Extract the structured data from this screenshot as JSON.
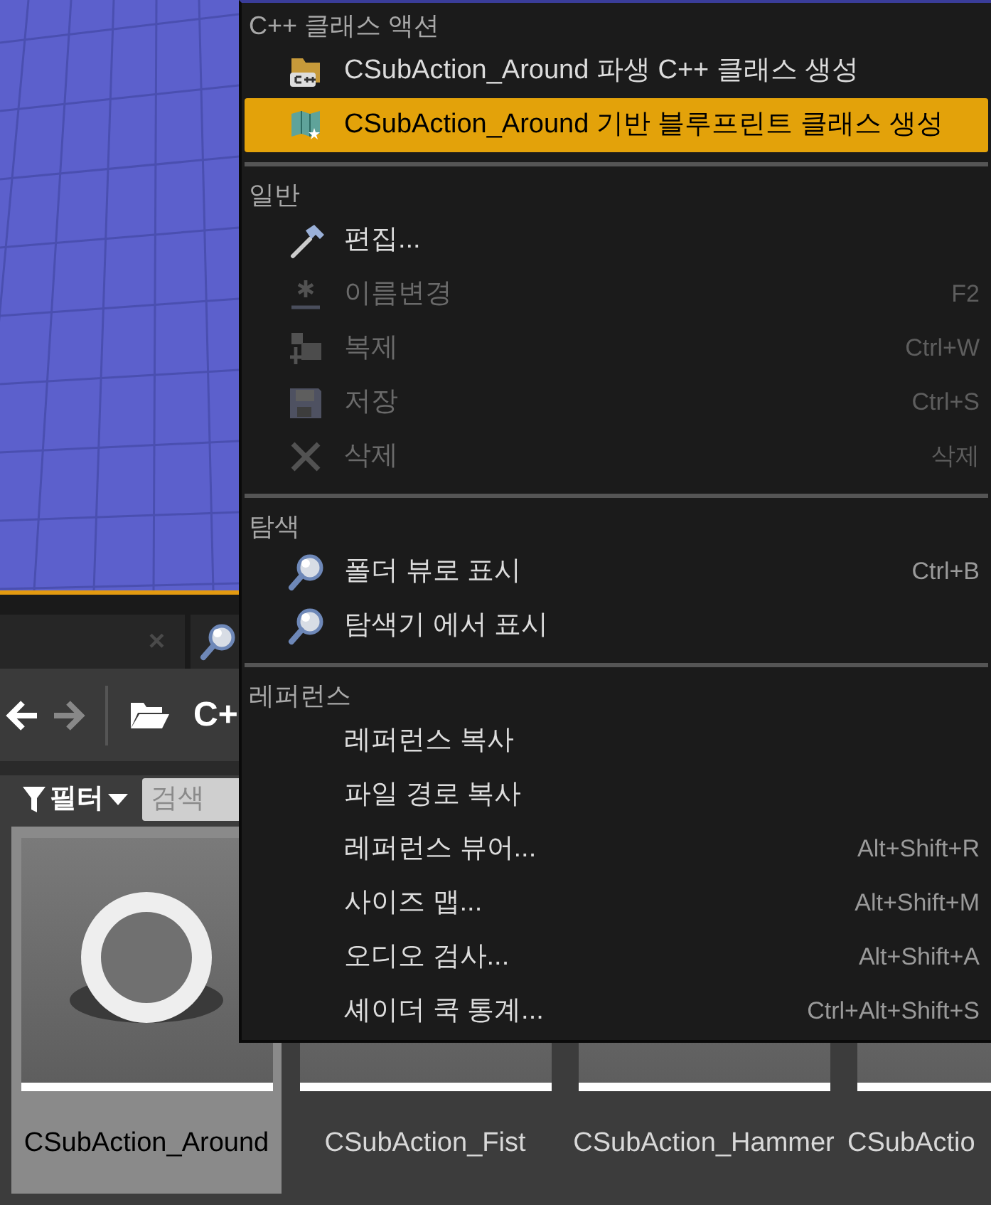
{
  "browser": {
    "tab_close": "×",
    "nav_path": "C+",
    "filter": "필터",
    "search": {
      "placeholder": "검색"
    }
  },
  "assets": [
    {
      "name": "CSubAction_Around",
      "selected": true,
      "kind": "ring"
    },
    {
      "name": "CSubAction_Fist",
      "selected": false,
      "kind": "blank"
    },
    {
      "name": "CSubAction_Hammer",
      "selected": false,
      "kind": "blank"
    },
    {
      "name": "CSubActio",
      "selected": false,
      "kind": "partial"
    }
  ],
  "context_menu": {
    "sections": [
      {
        "title": "C++ 클래스 액션",
        "items": [
          {
            "label": "CSubAction_Around 파생 C++ 클래스 생성",
            "highlighted": false,
            "disabled": false
          },
          {
            "label": "CSubAction_Around 기반 블루프린트 클래스 생성",
            "highlighted": true,
            "disabled": false
          }
        ]
      },
      {
        "title": "일반",
        "items": [
          {
            "label": "편집...",
            "highlighted": false,
            "disabled": false
          },
          {
            "label": "이름변경",
            "shortcut": "F2",
            "highlighted": false,
            "disabled": true
          },
          {
            "label": "복제",
            "shortcut": "Ctrl+W",
            "highlighted": false,
            "disabled": true
          },
          {
            "label": "저장",
            "shortcut": "Ctrl+S",
            "highlighted": false,
            "disabled": true
          },
          {
            "label": "삭제",
            "shortcut": "삭제",
            "highlighted": false,
            "disabled": true
          }
        ]
      },
      {
        "title": "탐색",
        "items": [
          {
            "label": "폴더 뷰로 표시",
            "shortcut": "Ctrl+B",
            "highlighted": false,
            "disabled": false
          },
          {
            "label": "탐색기 에서 표시",
            "highlighted": false,
            "disabled": false
          }
        ]
      },
      {
        "title": "레퍼런스",
        "items": [
          {
            "label": "레퍼런스 복사",
            "highlighted": false,
            "disabled": false
          },
          {
            "label": "파일 경로 복사",
            "highlighted": false,
            "disabled": false
          },
          {
            "label": "레퍼런스 뷰어...",
            "shortcut": "Alt+Shift+R",
            "highlighted": false,
            "disabled": false
          },
          {
            "label": "사이즈 맵...",
            "shortcut": "Alt+Shift+M",
            "highlighted": false,
            "disabled": false
          },
          {
            "label": "오디오 검사...",
            "shortcut": "Alt+Shift+A",
            "highlighted": false,
            "disabled": false
          },
          {
            "label": "셰이더 쿡 통계...",
            "shortcut": "Ctrl+Alt+Shift+S",
            "highlighted": false,
            "disabled": false
          }
        ]
      }
    ]
  }
}
